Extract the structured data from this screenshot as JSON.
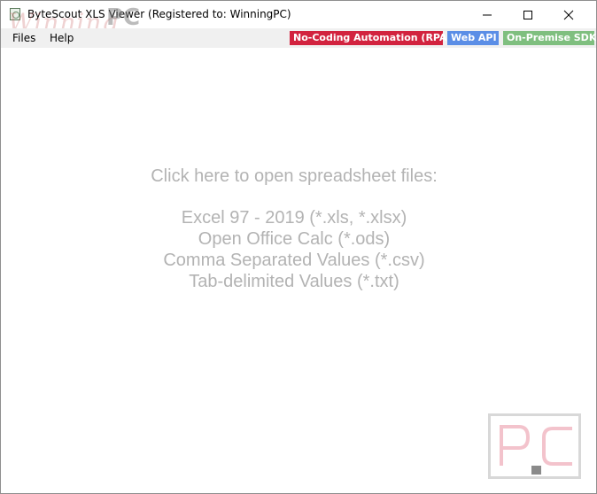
{
  "window": {
    "title": "ByteScout XLS Viewer (Registered to: WinningPC)",
    "watermark_script": "Winning",
    "watermark_pc": "PC"
  },
  "icons": {
    "app": "spreadsheet-app-icon",
    "minimize": "minimize-icon",
    "maximize": "maximize-icon",
    "close": "close-icon",
    "logo": "pc-logo-icon"
  },
  "menu": {
    "files": "Files",
    "help": "Help"
  },
  "badges": [
    {
      "label": "No-Coding Automation (RPA)",
      "color": "#d2233f"
    },
    {
      "label": "Web API",
      "color": "#5b8ee6"
    },
    {
      "label": "On-Premise SDK",
      "color": "#7fbf7f"
    }
  ],
  "main": {
    "lines": [
      "Click here to open spreadsheet files:",
      "Excel 97 - 2019 (*.xls, *.xlsx)",
      "Open Office Calc (*.ods)",
      "Comma Separated Values (*.csv)",
      "Tab-delimited Values (*.txt)"
    ]
  },
  "colors": {
    "main_text": "#b3b3b3",
    "logo_letters": "#f3c3cc"
  }
}
